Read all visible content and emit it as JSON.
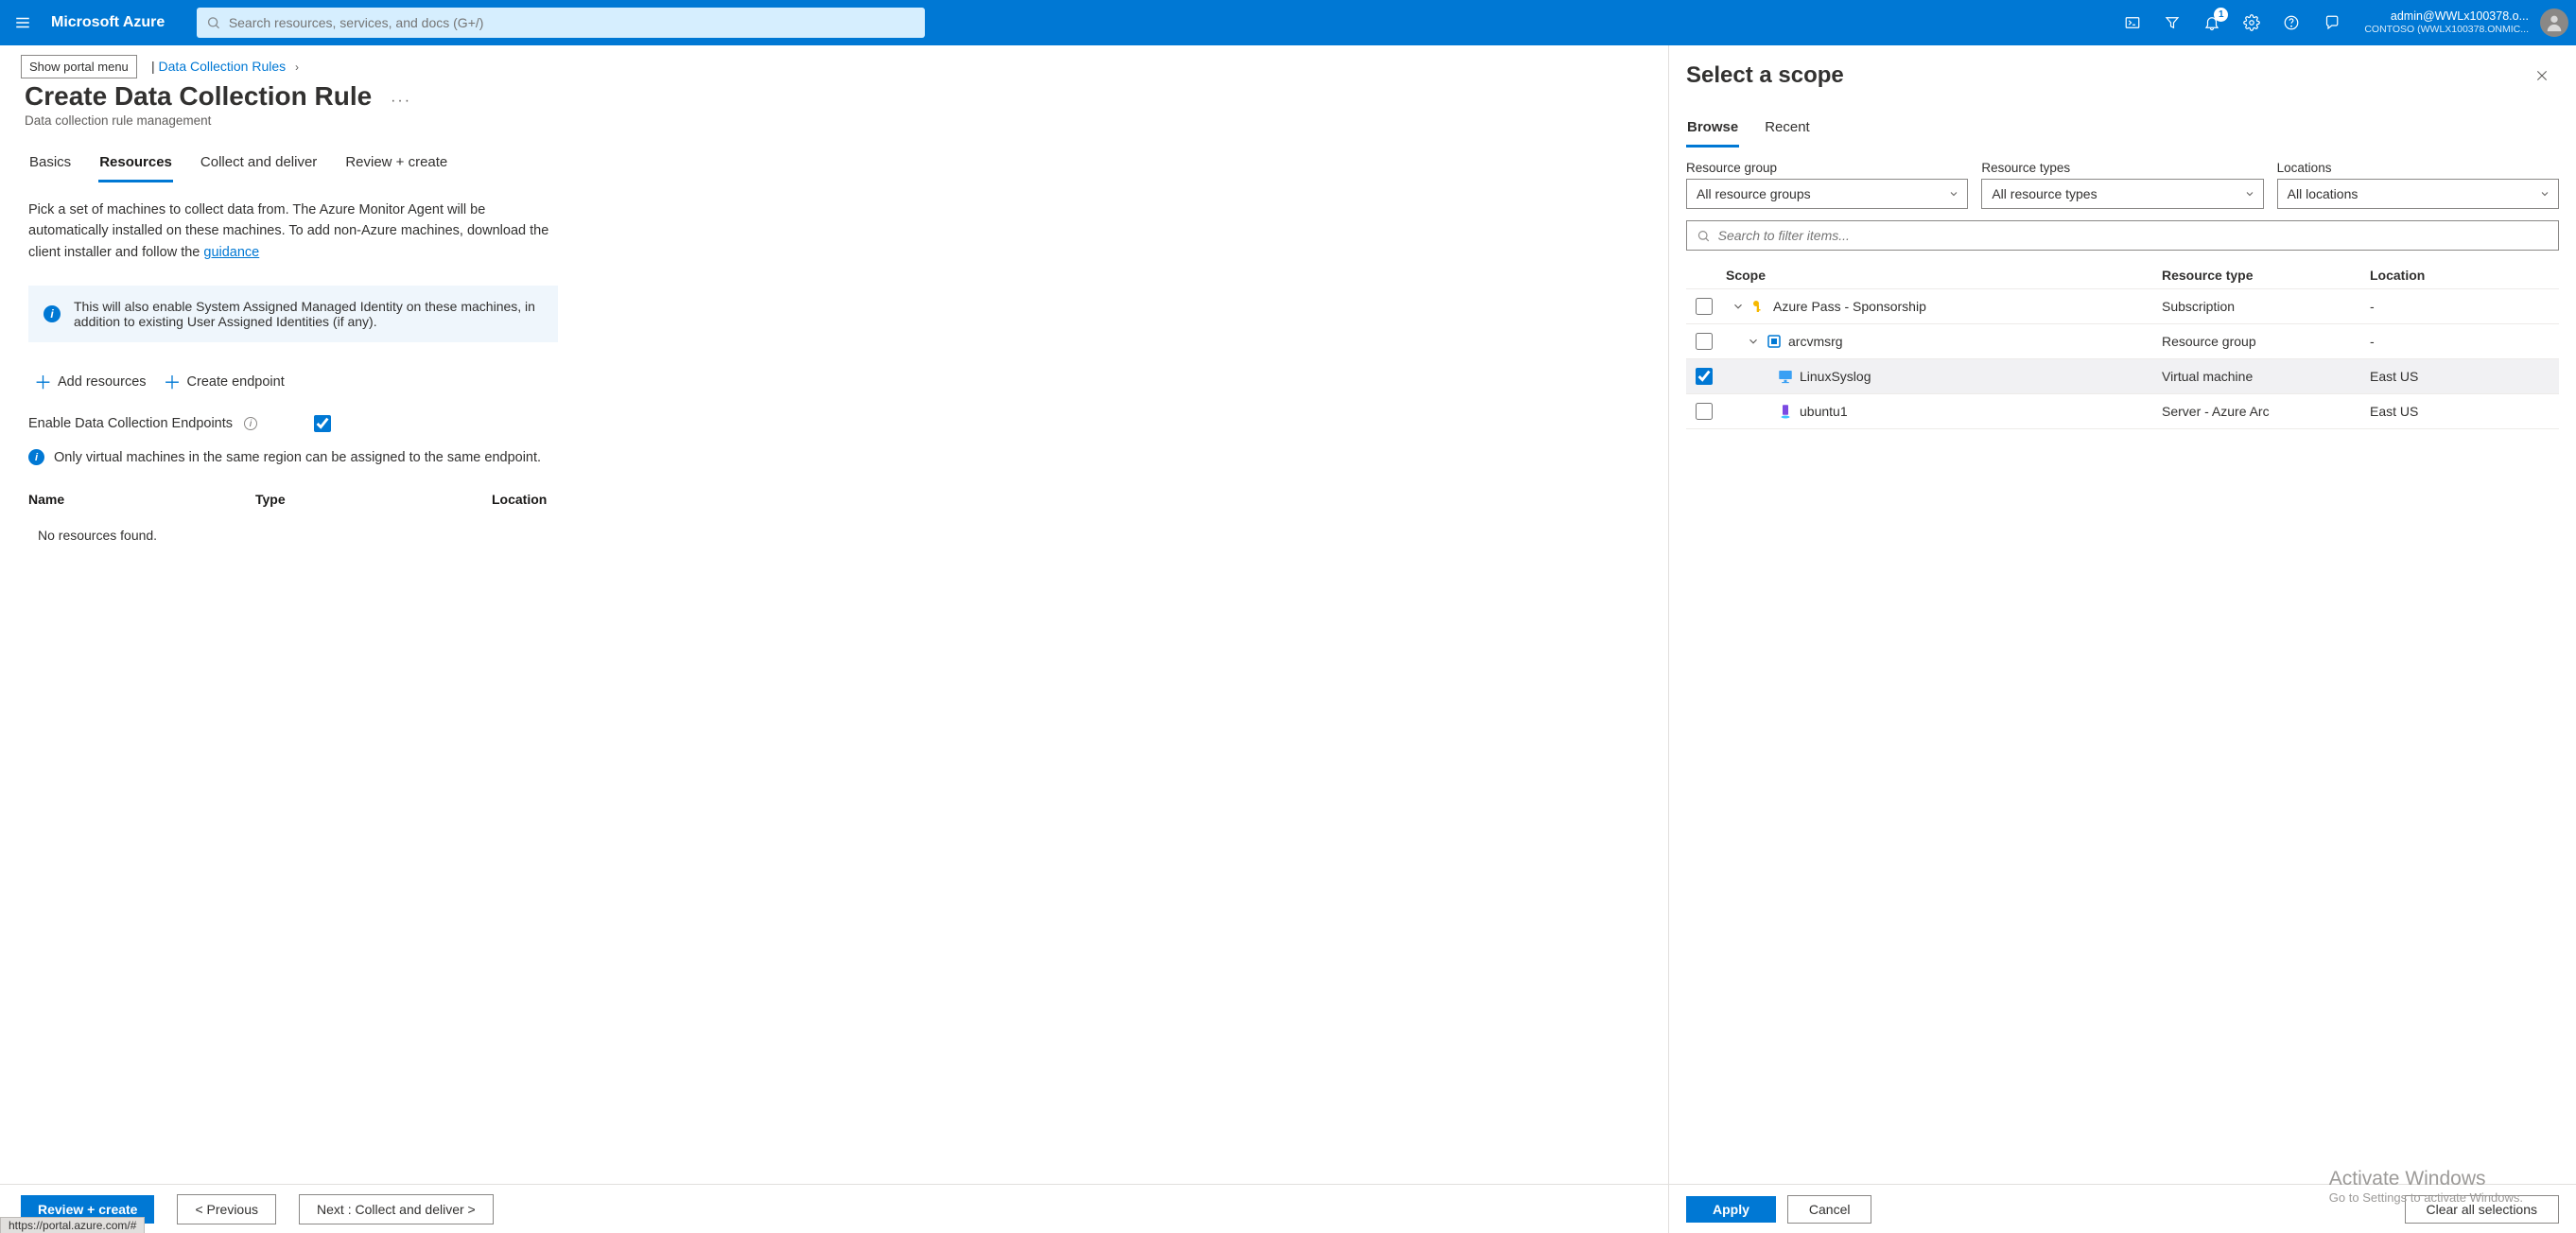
{
  "topbar": {
    "brand": "Microsoft Azure",
    "search_placeholder": "Search resources, services, and docs (G+/)",
    "notification_count": "1",
    "account_line1": "admin@WWLx100378.o...",
    "account_line2": "CONTOSO (WWLX100378.ONMIC..."
  },
  "tooltip": "Show portal menu",
  "breadcrumb": {
    "item1": "Data Collection Rules",
    "sep": "›"
  },
  "header": {
    "title": "Create Data Collection Rule",
    "subtitle": "Data collection rule management",
    "dots": "···"
  },
  "main_tabs": {
    "t0": "Basics",
    "t1": "Resources",
    "t2": "Collect and deliver",
    "t3": "Review + create"
  },
  "desc": {
    "line": "Pick a set of machines to collect data from. The Azure Monitor Agent will be automatically installed on these machines. To add non-Azure machines, download the client installer and follow the ",
    "link": "guidance"
  },
  "info_blue": "This will also enable System Assigned Managed Identity on these machines, in addition to existing User Assigned Identities (if any).",
  "actions": {
    "add": "Add resources",
    "endpoint": "Create endpoint"
  },
  "endpoints_label": "Enable Data Collection Endpoints",
  "info_plain": "Only virtual machines in the same region can be assigned to the same endpoint.",
  "table": {
    "h_name": "Name",
    "h_type": "Type",
    "h_loc": "Location",
    "empty": "No resources found."
  },
  "bottom": {
    "review": "Review + create",
    "prev": "<  Previous",
    "next": "Next : Collect and deliver  >"
  },
  "status_url": "https://portal.azure.com/#",
  "flyout": {
    "title": "Select a scope",
    "tabs": {
      "t0": "Browse",
      "t1": "Recent"
    },
    "filters": {
      "rg_label": "Resource group",
      "rg_val": "All resource groups",
      "rt_label": "Resource types",
      "rt_val": "All resource types",
      "loc_label": "Locations",
      "loc_val": "All locations"
    },
    "search_placeholder": "Search to filter items...",
    "columns": {
      "scope": "Scope",
      "type": "Resource type",
      "loc": "Location"
    },
    "rows": {
      "r0": {
        "name": "Azure Pass - Sponsorship",
        "type": "Subscription",
        "loc": "-"
      },
      "r1": {
        "name": "arcvmsrg",
        "type": "Resource group",
        "loc": "-"
      },
      "r2": {
        "name": "LinuxSyslog",
        "type": "Virtual machine",
        "loc": "East US"
      },
      "r3": {
        "name": "ubuntu1",
        "type": "Server - Azure Arc",
        "loc": "East US"
      }
    },
    "bottom": {
      "apply": "Apply",
      "cancel": "Cancel",
      "clear": "Clear all selections"
    }
  },
  "watermark": {
    "w1": "Activate Windows",
    "w2": "Go to Settings to activate Windows."
  }
}
